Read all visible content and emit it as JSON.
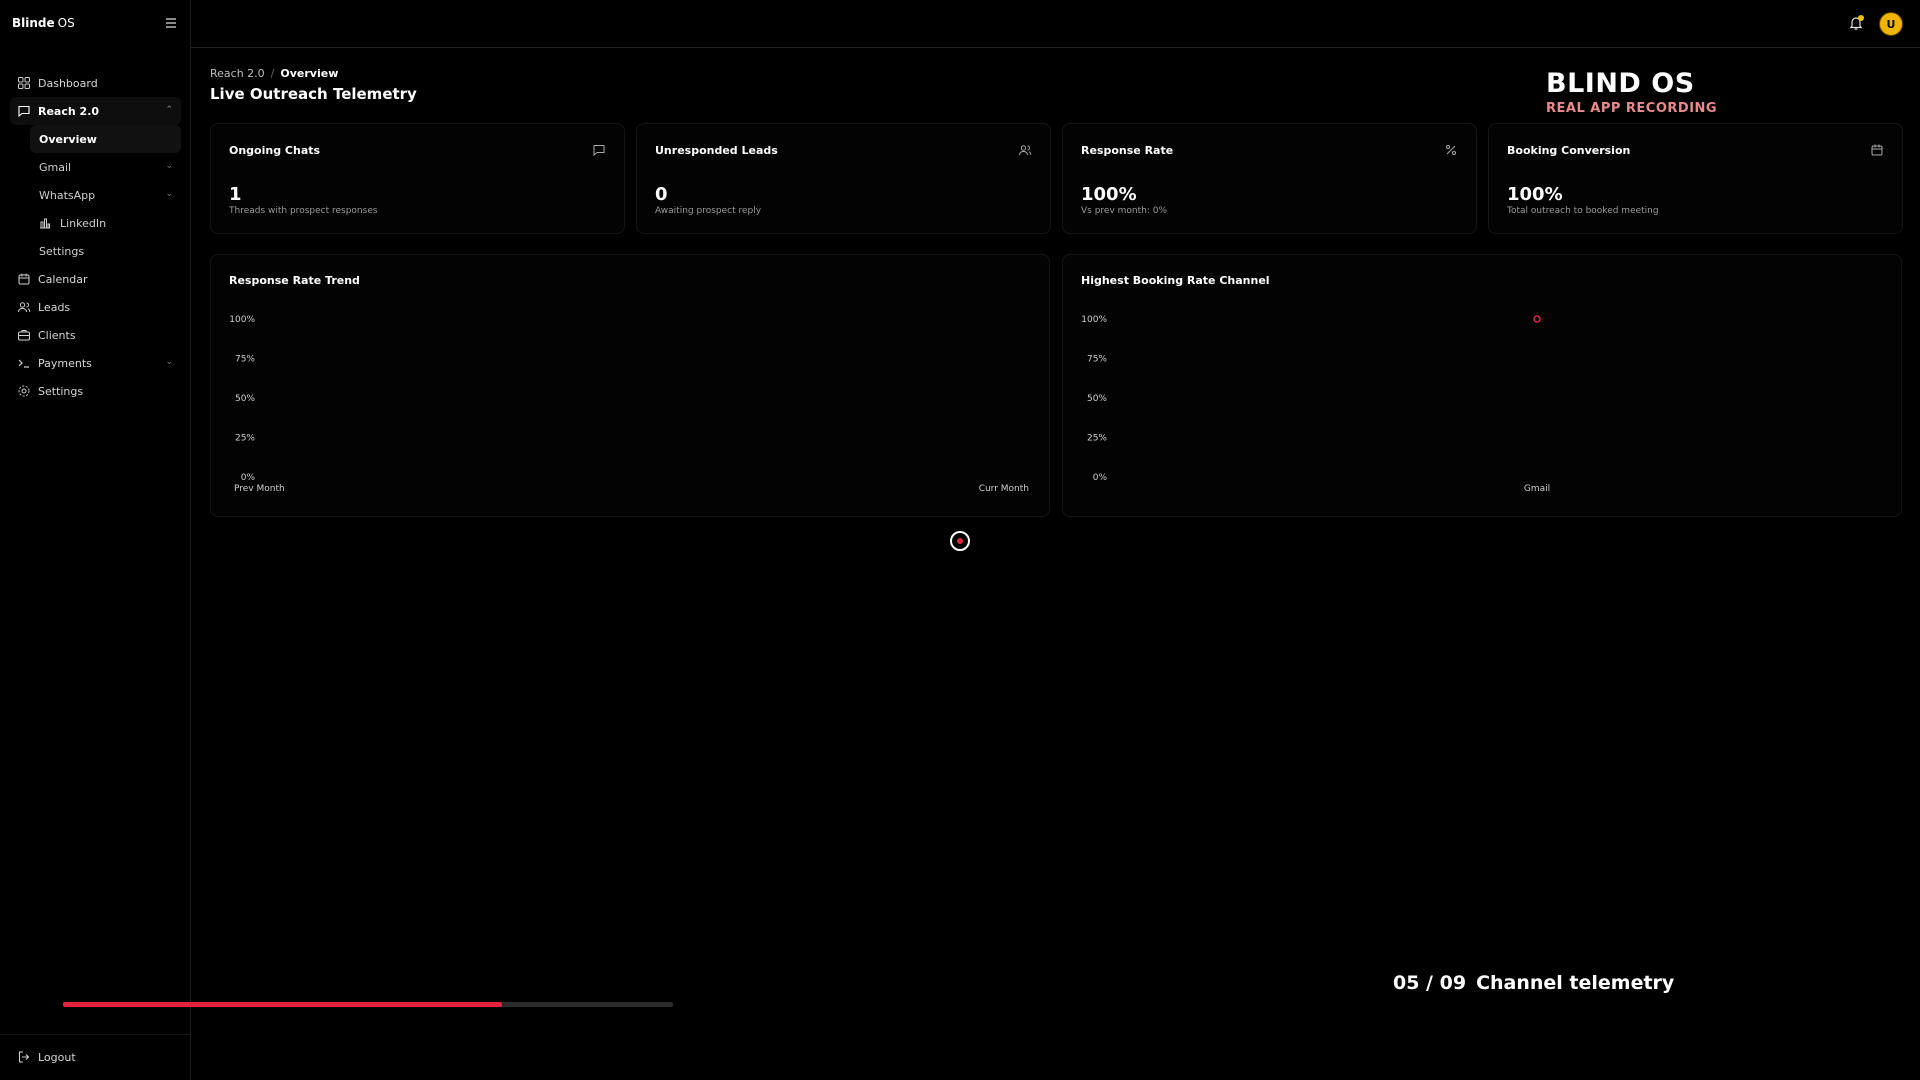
{
  "sidebar": {
    "brand_bold": "Blinde",
    "brand_light": "OS",
    "items": [
      {
        "label": "Dashboard",
        "icon": "grid-icon"
      },
      {
        "label": "Reach 2.0",
        "icon": "message-icon",
        "expanded": true
      },
      {
        "label": "Calendar",
        "icon": "calendar-icon"
      },
      {
        "label": "Leads",
        "icon": "users-icon"
      },
      {
        "label": "Clients",
        "icon": "briefcase-icon"
      },
      {
        "label": "Payments",
        "icon": "terminal-icon"
      },
      {
        "label": "Settings",
        "icon": "gear-icon"
      }
    ],
    "sub_items": [
      {
        "label": "Overview",
        "active": true
      },
      {
        "label": "Gmail"
      },
      {
        "label": "WhatsApp"
      },
      {
        "label": "LinkedIn",
        "icon": "chart-bar-icon"
      },
      {
        "label": "Settings"
      }
    ],
    "logout_label": "Logout"
  },
  "topbar": {
    "avatar_initial": "U"
  },
  "breadcrumb": {
    "parent": "Reach 2.0",
    "separator": "/",
    "current": "Overview"
  },
  "page_title": "Live Outreach Telemetry",
  "watermark": {
    "title": "BLIND OS",
    "subtitle": "REAL APP RECORDING"
  },
  "stats": [
    {
      "label": "Ongoing Chats",
      "value": "1",
      "desc": "Threads with prospect responses",
      "icon": "chat-icon"
    },
    {
      "label": "Unresponded Leads",
      "value": "0",
      "desc": "Awaiting prospect reply",
      "icon": "users-icon"
    },
    {
      "label": "Response Rate",
      "value": "100%",
      "desc": "Vs prev month: 0%",
      "icon": "percent-icon"
    },
    {
      "label": "Booking Conversion",
      "value": "100%",
      "desc": "Total outreach to booked meeting",
      "icon": "calendar-icon"
    }
  ],
  "chart_data": [
    {
      "type": "line",
      "title": "Response Rate Trend",
      "categories": [
        "Prev Month",
        "Curr Month"
      ],
      "yticks": [
        "100%",
        "75%",
        "50%",
        "25%",
        "0%"
      ],
      "ylim": [
        0,
        100
      ],
      "series": [
        {
          "values": [
            null,
            null
          ]
        }
      ]
    },
    {
      "type": "scatter",
      "title": "Highest Booking Rate Channel",
      "categories": [
        "Gmail"
      ],
      "yticks": [
        "100%",
        "75%",
        "50%",
        "25%",
        "0%"
      ],
      "ylim": [
        0,
        100
      ],
      "series": [
        {
          "values": [
            100
          ],
          "color": "#e3223d"
        }
      ]
    }
  ],
  "step": {
    "number": "05 / 09",
    "label": "Channel telemetry"
  },
  "progress": {
    "fraction": 0.72,
    "color": "#e3223d"
  }
}
